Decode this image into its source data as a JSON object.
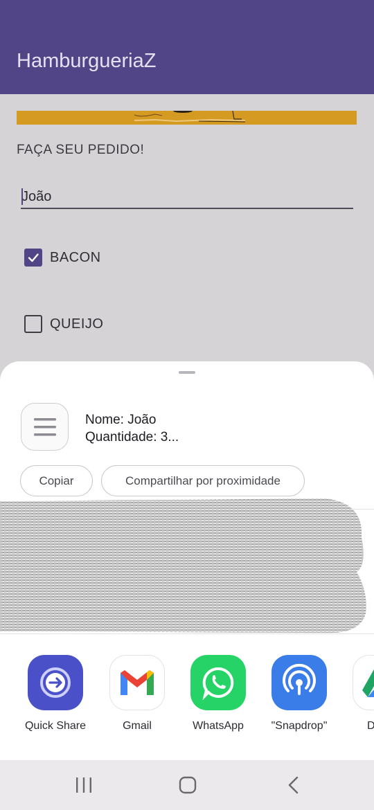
{
  "app": {
    "title": "HamburgueriaZ"
  },
  "form": {
    "order_label": "FAÇA SEU PEDIDO!",
    "name_value": "João",
    "options": [
      {
        "label": "BACON",
        "checked": true
      },
      {
        "label": "QUEIJO",
        "checked": false
      }
    ]
  },
  "share_sheet": {
    "preview": {
      "icon": "text-lines-icon",
      "line1": "Nome: João",
      "line2": "Quantidade: 3..."
    },
    "actions": {
      "copy": "Copiar",
      "nearby": "Compartilhar por proximidade"
    },
    "apps": [
      {
        "label": "Quick Share",
        "icon": "quick-share-icon",
        "color": "#4a50c8"
      },
      {
        "label": "Gmail",
        "icon": "gmail-icon",
        "color": "#ea4335"
      },
      {
        "label": "WhatsApp",
        "icon": "whatsapp-icon",
        "color": "#25d366"
      },
      {
        "label": "\"Snapdrop\"",
        "icon": "snapdrop-icon",
        "color": "#3b7de8"
      },
      {
        "label": "D",
        "icon": "drive-icon",
        "color": "#1fa463"
      }
    ]
  },
  "system_nav": {
    "recents": "recents-icon",
    "home": "home-icon",
    "back": "back-icon"
  },
  "colors": {
    "primary": "#524587",
    "banner": "#d59a22",
    "scrim": "#d5d3d6"
  }
}
